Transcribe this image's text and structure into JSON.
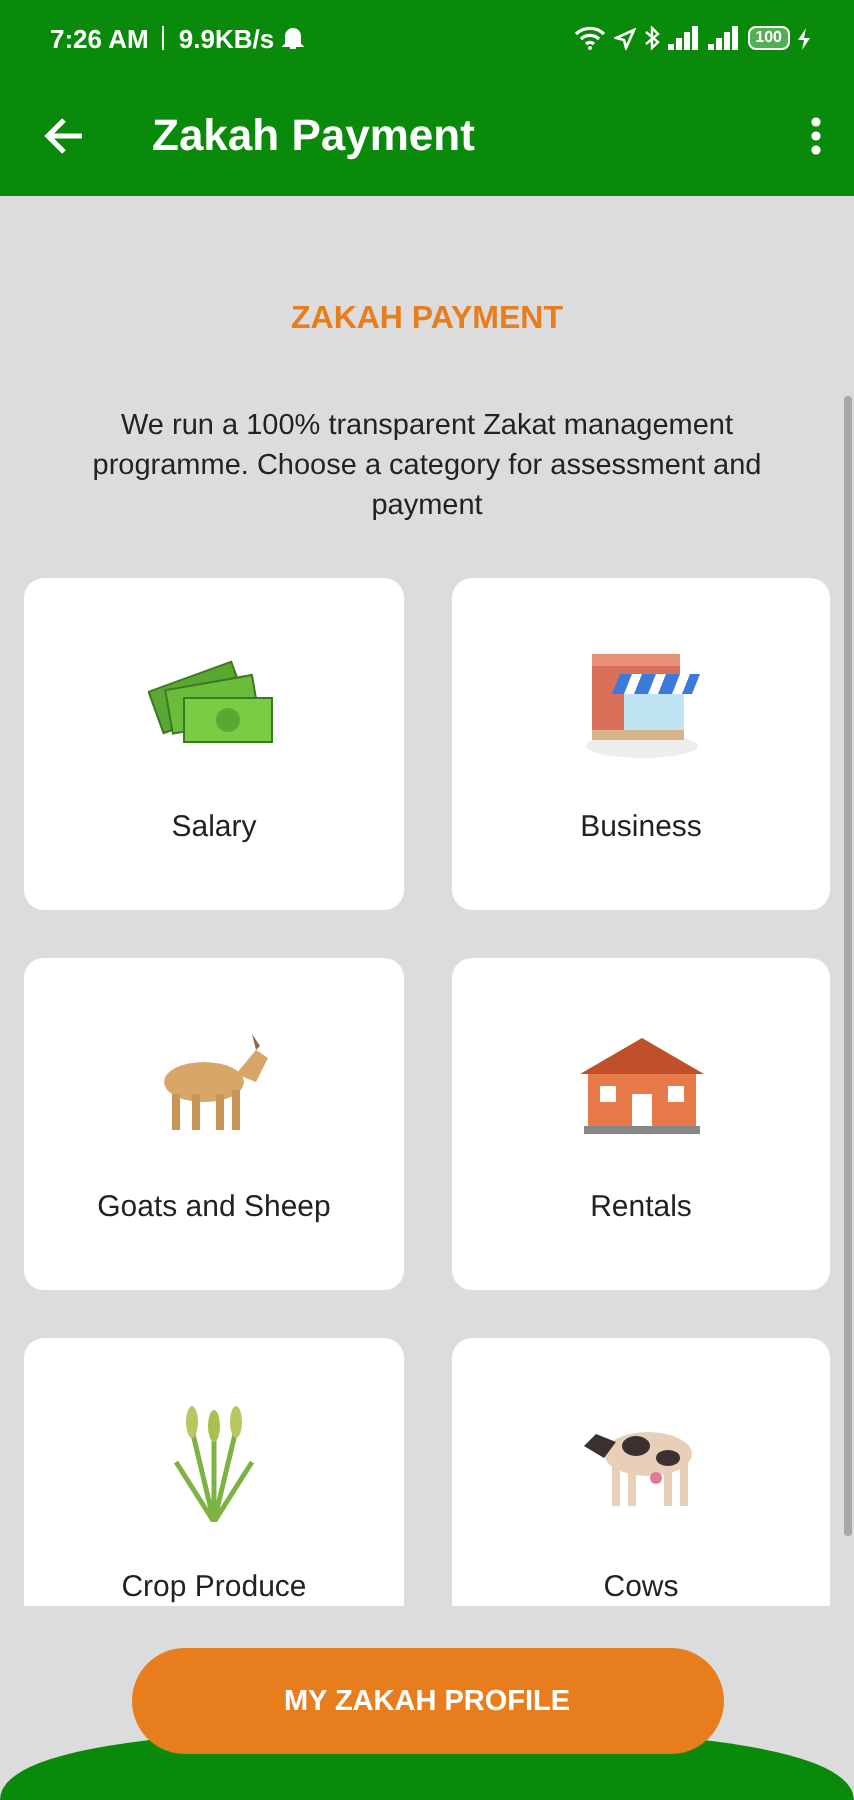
{
  "status_bar": {
    "time": "7:26 AM",
    "speed": "9.9KB/s",
    "battery": "100"
  },
  "app_bar": {
    "title": "Zakah Payment"
  },
  "heading": "ZAKAH PAYMENT",
  "description": "We run a 100% transparent Zakat management programme. Choose a category for assessment and payment",
  "categories": [
    {
      "label": "Salary",
      "kind": "cash"
    },
    {
      "label": "Business",
      "kind": "shop"
    },
    {
      "label": "Goats and Sheep",
      "kind": "goat"
    },
    {
      "label": "Rentals",
      "kind": "house"
    },
    {
      "label": "Crop Produce",
      "kind": "wheat"
    },
    {
      "label": "Cows",
      "kind": "cow"
    }
  ],
  "profile_button": "MY ZAKAH PROFILE"
}
